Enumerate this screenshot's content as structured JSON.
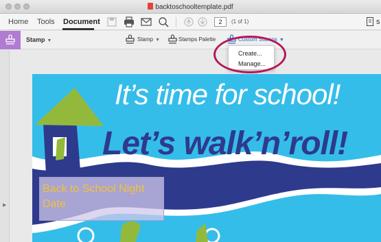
{
  "window": {
    "title": "backtoschooltemplate.pdf"
  },
  "toolbar": {
    "nav": [
      "Home",
      "Tools",
      "Document"
    ],
    "page_number": "2",
    "page_of": "(1 of 1)",
    "right_cut": "s"
  },
  "stamp_bar": {
    "tool_label": "Stamp",
    "stamp_button": "Stamp",
    "stamps_palette": "Stamps Palette",
    "custom_stamps": "Custom Stamps"
  },
  "custom_stamps_menu": {
    "items": [
      "Create...",
      "Manage..."
    ]
  },
  "document": {
    "headline_top": "It’s time for school!",
    "headline_bottom": "Let’s walk’n’roll!",
    "form_field_text": "Back to School Night Date"
  },
  "colors": {
    "stamp_tool_accent": "#b07bd0",
    "highlight_ring": "#b5175a",
    "page_background": "#35bdea",
    "headline_bottom": "#2e3a8c",
    "house_roof": "#93b93c",
    "house_body": "#2e3a8c",
    "form_text": "#f2c23a"
  },
  "icons": {
    "save": "save-icon",
    "print": "print-icon",
    "email": "mail-icon",
    "search": "search-icon",
    "prev_page": "arrow-up-circle-icon",
    "next_page": "arrow-down-circle-icon",
    "stamp": "stamp-icon"
  }
}
